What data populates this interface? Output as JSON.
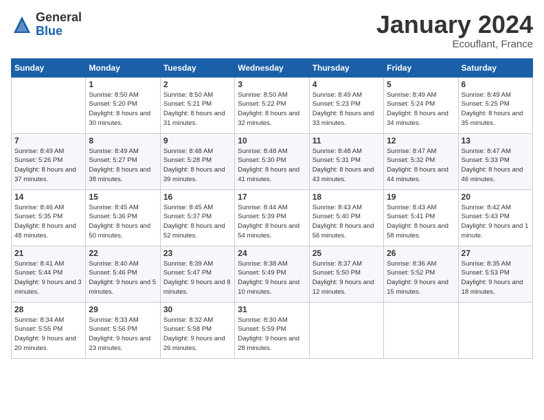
{
  "logo": {
    "general": "General",
    "blue": "Blue"
  },
  "header": {
    "month": "January 2024",
    "location": "Ecouflant, France"
  },
  "weekdays": [
    "Sunday",
    "Monday",
    "Tuesday",
    "Wednesday",
    "Thursday",
    "Friday",
    "Saturday"
  ],
  "weeks": [
    [
      {
        "day": "",
        "sunrise": "",
        "sunset": "",
        "daylight": ""
      },
      {
        "day": "1",
        "sunrise": "Sunrise: 8:50 AM",
        "sunset": "Sunset: 5:20 PM",
        "daylight": "Daylight: 8 hours and 30 minutes."
      },
      {
        "day": "2",
        "sunrise": "Sunrise: 8:50 AM",
        "sunset": "Sunset: 5:21 PM",
        "daylight": "Daylight: 8 hours and 31 minutes."
      },
      {
        "day": "3",
        "sunrise": "Sunrise: 8:50 AM",
        "sunset": "Sunset: 5:22 PM",
        "daylight": "Daylight: 8 hours and 32 minutes."
      },
      {
        "day": "4",
        "sunrise": "Sunrise: 8:49 AM",
        "sunset": "Sunset: 5:23 PM",
        "daylight": "Daylight: 8 hours and 33 minutes."
      },
      {
        "day": "5",
        "sunrise": "Sunrise: 8:49 AM",
        "sunset": "Sunset: 5:24 PM",
        "daylight": "Daylight: 8 hours and 34 minutes."
      },
      {
        "day": "6",
        "sunrise": "Sunrise: 8:49 AM",
        "sunset": "Sunset: 5:25 PM",
        "daylight": "Daylight: 8 hours and 35 minutes."
      }
    ],
    [
      {
        "day": "7",
        "sunrise": "Sunrise: 8:49 AM",
        "sunset": "Sunset: 5:26 PM",
        "daylight": "Daylight: 8 hours and 37 minutes."
      },
      {
        "day": "8",
        "sunrise": "Sunrise: 8:49 AM",
        "sunset": "Sunset: 5:27 PM",
        "daylight": "Daylight: 8 hours and 38 minutes."
      },
      {
        "day": "9",
        "sunrise": "Sunrise: 8:48 AM",
        "sunset": "Sunset: 5:28 PM",
        "daylight": "Daylight: 8 hours and 39 minutes."
      },
      {
        "day": "10",
        "sunrise": "Sunrise: 8:48 AM",
        "sunset": "Sunset: 5:30 PM",
        "daylight": "Daylight: 8 hours and 41 minutes."
      },
      {
        "day": "11",
        "sunrise": "Sunrise: 8:48 AM",
        "sunset": "Sunset: 5:31 PM",
        "daylight": "Daylight: 8 hours and 43 minutes."
      },
      {
        "day": "12",
        "sunrise": "Sunrise: 8:47 AM",
        "sunset": "Sunset: 5:32 PM",
        "daylight": "Daylight: 8 hours and 44 minutes."
      },
      {
        "day": "13",
        "sunrise": "Sunrise: 8:47 AM",
        "sunset": "Sunset: 5:33 PM",
        "daylight": "Daylight: 8 hours and 46 minutes."
      }
    ],
    [
      {
        "day": "14",
        "sunrise": "Sunrise: 8:46 AM",
        "sunset": "Sunset: 5:35 PM",
        "daylight": "Daylight: 8 hours and 48 minutes."
      },
      {
        "day": "15",
        "sunrise": "Sunrise: 8:45 AM",
        "sunset": "Sunset: 5:36 PM",
        "daylight": "Daylight: 8 hours and 50 minutes."
      },
      {
        "day": "16",
        "sunrise": "Sunrise: 8:45 AM",
        "sunset": "Sunset: 5:37 PM",
        "daylight": "Daylight: 8 hours and 52 minutes."
      },
      {
        "day": "17",
        "sunrise": "Sunrise: 8:44 AM",
        "sunset": "Sunset: 5:39 PM",
        "daylight": "Daylight: 8 hours and 54 minutes."
      },
      {
        "day": "18",
        "sunrise": "Sunrise: 8:43 AM",
        "sunset": "Sunset: 5:40 PM",
        "daylight": "Daylight: 8 hours and 56 minutes."
      },
      {
        "day": "19",
        "sunrise": "Sunrise: 8:43 AM",
        "sunset": "Sunset: 5:41 PM",
        "daylight": "Daylight: 8 hours and 58 minutes."
      },
      {
        "day": "20",
        "sunrise": "Sunrise: 8:42 AM",
        "sunset": "Sunset: 5:43 PM",
        "daylight": "Daylight: 9 hours and 1 minute."
      }
    ],
    [
      {
        "day": "21",
        "sunrise": "Sunrise: 8:41 AM",
        "sunset": "Sunset: 5:44 PM",
        "daylight": "Daylight: 9 hours and 3 minutes."
      },
      {
        "day": "22",
        "sunrise": "Sunrise: 8:40 AM",
        "sunset": "Sunset: 5:46 PM",
        "daylight": "Daylight: 9 hours and 5 minutes."
      },
      {
        "day": "23",
        "sunrise": "Sunrise: 8:39 AM",
        "sunset": "Sunset: 5:47 PM",
        "daylight": "Daylight: 9 hours and 8 minutes."
      },
      {
        "day": "24",
        "sunrise": "Sunrise: 8:38 AM",
        "sunset": "Sunset: 5:49 PM",
        "daylight": "Daylight: 9 hours and 10 minutes."
      },
      {
        "day": "25",
        "sunrise": "Sunrise: 8:37 AM",
        "sunset": "Sunset: 5:50 PM",
        "daylight": "Daylight: 9 hours and 12 minutes."
      },
      {
        "day": "26",
        "sunrise": "Sunrise: 8:36 AM",
        "sunset": "Sunset: 5:52 PM",
        "daylight": "Daylight: 9 hours and 15 minutes."
      },
      {
        "day": "27",
        "sunrise": "Sunrise: 8:35 AM",
        "sunset": "Sunset: 5:53 PM",
        "daylight": "Daylight: 9 hours and 18 minutes."
      }
    ],
    [
      {
        "day": "28",
        "sunrise": "Sunrise: 8:34 AM",
        "sunset": "Sunset: 5:55 PM",
        "daylight": "Daylight: 9 hours and 20 minutes."
      },
      {
        "day": "29",
        "sunrise": "Sunrise: 8:33 AM",
        "sunset": "Sunset: 5:56 PM",
        "daylight": "Daylight: 9 hours and 23 minutes."
      },
      {
        "day": "30",
        "sunrise": "Sunrise: 8:32 AM",
        "sunset": "Sunset: 5:58 PM",
        "daylight": "Daylight: 9 hours and 26 minutes."
      },
      {
        "day": "31",
        "sunrise": "Sunrise: 8:30 AM",
        "sunset": "Sunset: 5:59 PM",
        "daylight": "Daylight: 9 hours and 28 minutes."
      },
      {
        "day": "",
        "sunrise": "",
        "sunset": "",
        "daylight": ""
      },
      {
        "day": "",
        "sunrise": "",
        "sunset": "",
        "daylight": ""
      },
      {
        "day": "",
        "sunrise": "",
        "sunset": "",
        "daylight": ""
      }
    ]
  ]
}
